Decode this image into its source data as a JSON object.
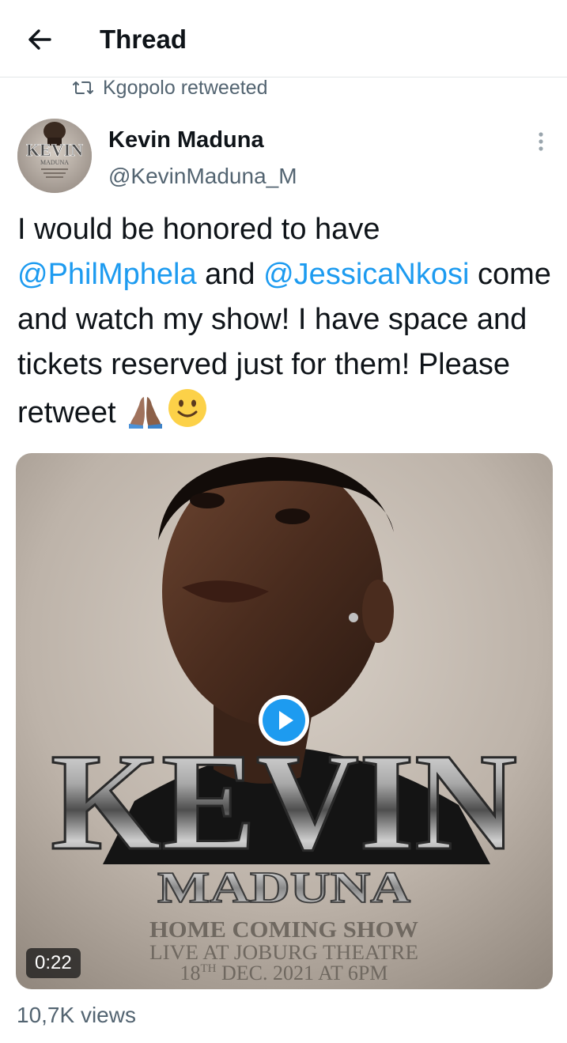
{
  "header": {
    "title": "Thread",
    "back_icon": "arrow-left-icon"
  },
  "context": {
    "retweet_label": "Kgopolo retweeted",
    "icon": "retweet-icon"
  },
  "author": {
    "name": "Kevin Maduna",
    "handle": "@KevinMaduna_M",
    "avatar_text": "KEVIN",
    "avatar_subtext": "MADUNA"
  },
  "tweet": {
    "part1": "I would be honored to have ",
    "mention1": "@PhilMphela",
    "part2": " and ",
    "mention2": "@JessicaNkosi",
    "part3": " come and watch my show! I have space and tickets reserved just for them! Please retweet ",
    "emoji1": "folded-hands-emoji",
    "emoji2": "slightly-smiling-face-emoji"
  },
  "media": {
    "poster_title": "KEVIN",
    "poster_subtitle": "MADUNA",
    "show_line1": "HOME COMING SHOW",
    "show_line2": "LIVE AT JOBURG THEATRE",
    "show_date_day": "18",
    "show_date_sup": "TH",
    "show_date_rest": " DEC. 2021 AT 6PM",
    "duration": "0:22",
    "play_icon": "play-icon"
  },
  "stats": {
    "views": "10,7K views"
  },
  "colors": {
    "accent": "#1d9bf0",
    "secondary_text": "#536471",
    "text": "#0f1419"
  }
}
